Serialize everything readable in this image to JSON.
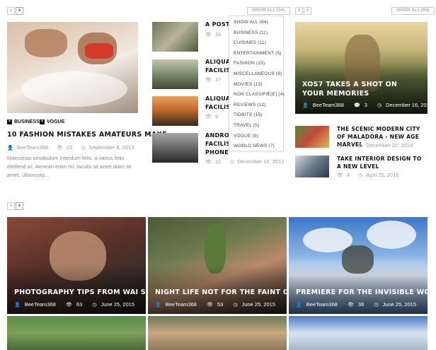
{
  "nav": {
    "prev": "‹",
    "next": "›"
  },
  "left": {
    "tags": [
      "BUSINESS",
      "VOGUE"
    ],
    "title": "10 FASHION MISTAKES AMATEURS MAKE",
    "author": "BeeTeam368",
    "views": "22",
    "date": "September 8, 2013",
    "excerpt": "Maecenas vestibulum interdum felis, a varius felis eleifend ac. Aenean enim mi, iaculis sit amet diam sit amet, ullamcorp..."
  },
  "middle": {
    "show_all": "SHOW ALL (94)",
    "items": [
      {
        "title": "A POST W",
        "views": "33",
        "date": ""
      },
      {
        "title": "ALIQUAM\nFACILISIS",
        "views": "17",
        "date": ""
      },
      {
        "title": "ALIQUAM\nFACILISIS",
        "views": "9",
        "date": ""
      },
      {
        "title": "ANDROID\nFACILISIS\nPHONE",
        "views": "12",
        "date": "December 16, 2013"
      }
    ],
    "dropdown": [
      "SHOW ALL (94)",
      "BUSINESS (11)",
      "CUISINES (11)",
      "ENTERTAINMENT (5)",
      "FASHION (15)",
      "MISCELLANEOUS (8)",
      "MOVIES (13)",
      "NON CLASSIFIÉ(E) (4)",
      "REVIEWS (12)",
      "TIDBITS (15)",
      "TRAVEL (5)",
      "VOGUE (9)",
      "WORLD NEWS (7)"
    ]
  },
  "right": {
    "show_all": "SHOW ALL (89)",
    "featured": {
      "title": "XOS7 TAKES A SHOT ON YOUR MEMORIES",
      "author": "BeeTeam368",
      "comments": "3",
      "date": "December 16, 2013"
    },
    "items": [
      {
        "title": "THE SCENIC MODERN CITY OF MALADORA - NEW AGE MARVEL",
        "views": "7",
        "date": "December 22, 2013"
      },
      {
        "title": "TAKE INTERIOR DESIGN TO A NEW LEVEL",
        "views": "4",
        "date": "April 25, 2015"
      }
    ]
  },
  "grid": [
    {
      "title": "PHOTOGRAPHY TIPS FROM WAI SU",
      "author": "BeeTeam368",
      "views": "63",
      "date": "June 25, 2015"
    },
    {
      "title": "NIGHT LIFE NOT FOR THE FAINT OF HEART",
      "author": "BeeTeam368",
      "views": "53",
      "date": "June 25, 2015"
    },
    {
      "title": "PREMIERE FOR THE INVISIBLE WOMAN",
      "author": "BeeTeam368",
      "views": "36",
      "date": "June 25, 2015"
    }
  ],
  "colors": {
    "accent": "#111111",
    "meta": "#999999",
    "border": "#cccccc"
  }
}
